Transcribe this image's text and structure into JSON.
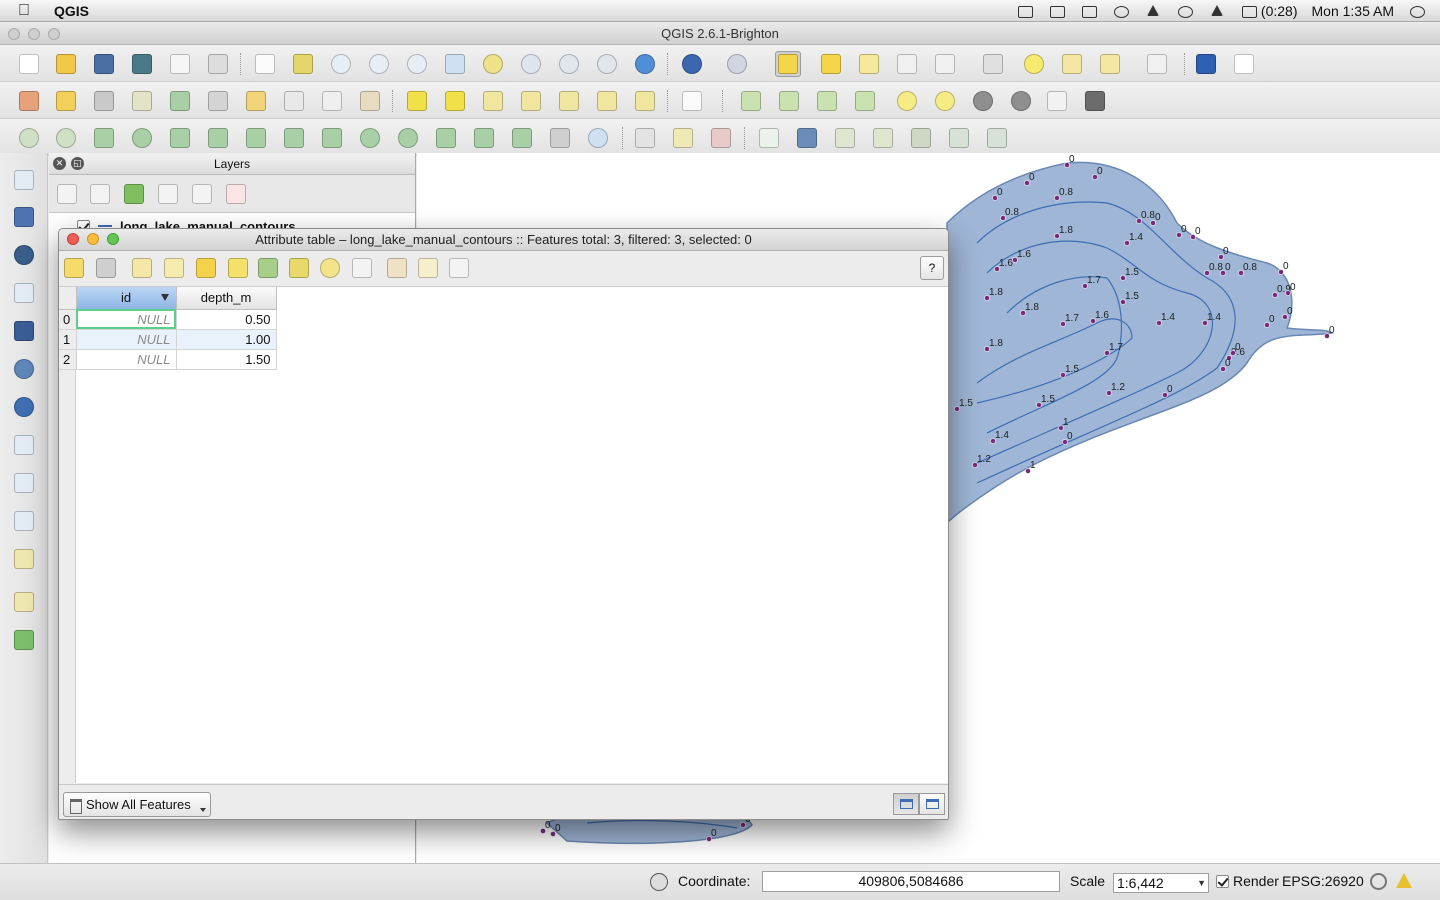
{
  "menubar": {
    "app_name": "QGIS",
    "battery": "(0:28)",
    "clock": "Mon 1:35 AM"
  },
  "window": {
    "title": "QGIS 2.6.1-Brighton"
  },
  "layers_panel": {
    "title": "Layers",
    "layers": [
      {
        "name": "long_lake_manual_contours",
        "visible": true
      }
    ]
  },
  "attribute_table": {
    "title": "Attribute table – long_lake_manual_contours :: Features total: 3, filtered: 3, selected: 0",
    "help_label": "?",
    "columns": [
      "id",
      "depth_m"
    ],
    "rows": [
      {
        "index": "0",
        "id": "NULL",
        "depth_m": "0.50"
      },
      {
        "index": "1",
        "id": "NULL",
        "depth_m": "1.00"
      },
      {
        "index": "2",
        "id": "NULL",
        "depth_m": "1.50"
      }
    ],
    "filter_label": "Show All Features"
  },
  "statusbar": {
    "coordinate_label": "Coordinate:",
    "coordinate_value": "409806,5084686",
    "scale_label": "Scale",
    "scale_value": "1:6,442",
    "render_label": "Render",
    "crs": "EPSG:26920"
  },
  "map": {
    "water_color": "#9fb6d6",
    "contour_color": "#3d6fb5",
    "point_color": "#7a2a7a",
    "labels": [
      "0",
      "0",
      "0",
      "0",
      "0.8",
      "0.8",
      "0.8",
      "0",
      "0",
      "0",
      "1.8",
      "1.4",
      "0",
      "0",
      "1.6",
      "1.6",
      "0.8",
      "0.8",
      "0",
      "1.7",
      "1.5",
      "0.9",
      "0",
      "1.8",
      "1.5",
      "0",
      "0",
      "1.8",
      "1.8",
      "1.7",
      "1.6",
      "1.4",
      "1.4",
      "1.7",
      "1.5",
      "0.6",
      "0",
      "0",
      "1.5",
      "1.2",
      "0",
      "1.5",
      "1.4",
      "1",
      "1.2",
      "0",
      "1",
      "0",
      "0",
      "0",
      "0",
      "0"
    ]
  }
}
